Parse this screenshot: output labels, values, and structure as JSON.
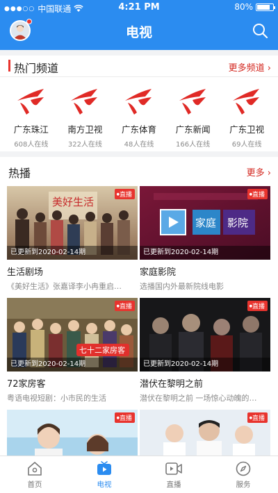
{
  "status_bar": {
    "carrier": "中国联通",
    "time": "4:21 PM",
    "battery_percent": "80%",
    "battery_level": 0.8
  },
  "header": {
    "title": "电视"
  },
  "hot_channels": {
    "title": "热门频道",
    "more_label": "更多频道 ›",
    "accent_color": "#e8342e",
    "items": [
      {
        "name": "广东珠江",
        "online": "608人在线"
      },
      {
        "name": "南方卫视",
        "online": "322人在线"
      },
      {
        "name": "广东体育",
        "online": "48人在线"
      },
      {
        "name": "广东新闻",
        "online": "166人在线"
      },
      {
        "name": "广东卫视",
        "online": "69人在线"
      }
    ]
  },
  "hot_play": {
    "title": "热播",
    "more_label": "更多 ›",
    "badge_label": "直播",
    "cards": [
      {
        "update": "已更新到2020-02-14期",
        "title": "生活剧场",
        "desc": "《美好生活》张嘉译李小冉重启…",
        "poster_text": "美好生活"
      },
      {
        "update": "已更新到2020-02-14期",
        "title": "家庭影院",
        "desc": "选播国内外最新院线电影",
        "poster_text_1": "家庭",
        "poster_text_2": "影院"
      },
      {
        "update": "已更新到2020-02-14期",
        "title": "72家房客",
        "desc": "粤语电视短剧：小市民的生活",
        "poster_text": "七十二家房客"
      },
      {
        "update": "已更新到2020-02-14期",
        "title": "潜伏在黎明之前",
        "desc": "潜伏在黎明之前 一场惊心动魄的…"
      },
      {
        "update": "",
        "title": "",
        "desc": ""
      },
      {
        "update": "",
        "title": "",
        "desc": ""
      }
    ]
  },
  "tab_bar": {
    "active_color": "#2b8cf0",
    "tabs": [
      {
        "label": "首页",
        "icon": "home-icon",
        "active": false
      },
      {
        "label": "电视",
        "icon": "tv-icon",
        "active": true
      },
      {
        "label": "直播",
        "icon": "live-video-icon",
        "active": false
      },
      {
        "label": "服务",
        "icon": "compass-icon",
        "active": false
      }
    ]
  }
}
